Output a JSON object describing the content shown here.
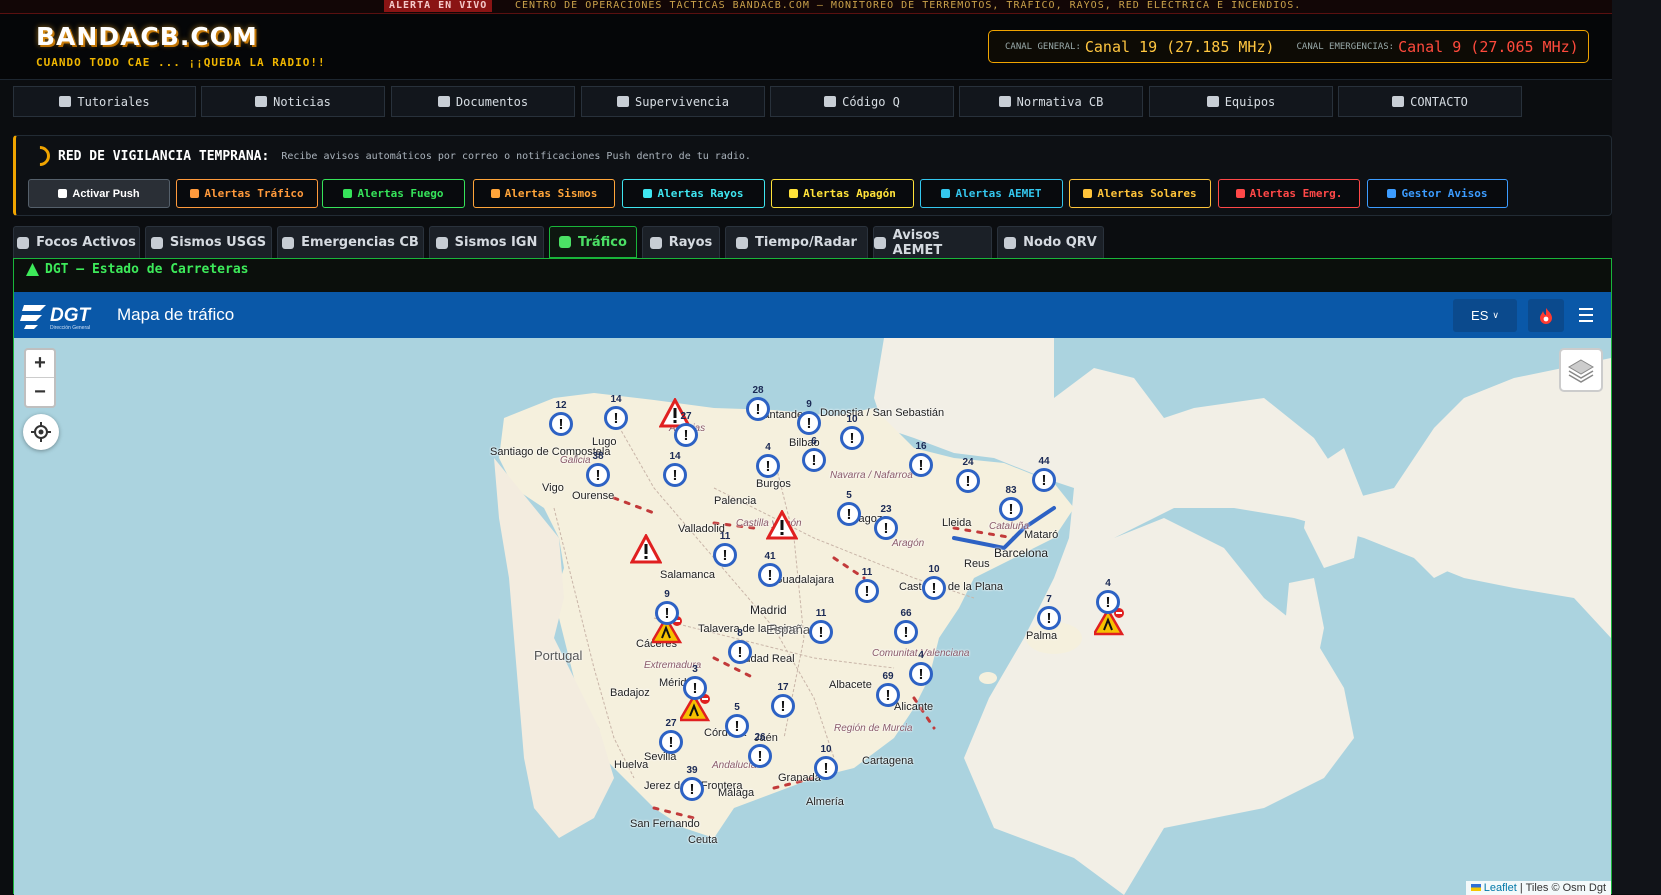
{
  "ticker": {
    "tag": "ALERTA EN VIVO",
    "message": "CENTRO DE OPERACIONES TÁCTICAS BANDACB.COM — MONITOREO DE TERREMOTOS, TRÁFICO, RAYOS, RED ELÉCTRICA E INCENDIOS."
  },
  "header": {
    "logo": "BANDACB.COM",
    "tagline": "CUANDO TODO CAE ... ¡¡QUEDA LA RADIO!!",
    "freq": {
      "general_label": "CANAL GENERAL:",
      "general_value": "Canal 19 (27.185 MHz)",
      "emergency_label": "CANAL EMERGENCIAS:",
      "emergency_value": "Canal 9 (27.065 MHz)"
    }
  },
  "nav": [
    {
      "label": "Tutoriales",
      "icon": "newspaper-icon"
    },
    {
      "label": "Noticias",
      "icon": "newspaper-icon"
    },
    {
      "label": "Documentos",
      "icon": "file-icon"
    },
    {
      "label": "Supervivencia",
      "icon": "kit-icon"
    },
    {
      "label": "Código Q",
      "icon": "id-card-icon"
    },
    {
      "label": "Normativa CB",
      "icon": "gavel-icon"
    },
    {
      "label": "Equipos",
      "icon": "radio-icon"
    },
    {
      "label": "CONTACTO",
      "icon": "envelope-icon"
    }
  ],
  "vigilancia": {
    "title": "RED DE VIGILANCIA TEMPRANA:",
    "description": "Recibe avisos automáticos por correo o notificaciones Push dentro de tu radio.",
    "buttons": [
      {
        "label": "Activar Push",
        "color": "#ffffff"
      },
      {
        "label": "Alertas Tráfico",
        "color": "#ff9a3c"
      },
      {
        "label": "Alertas Fuego",
        "color": "#36e35a"
      },
      {
        "label": "Alertas Sismos",
        "color": "#ffa53a"
      },
      {
        "label": "Alertas Rayos",
        "color": "#3fe6f0"
      },
      {
        "label": "Alertas Apagón",
        "color": "#ffe23a"
      },
      {
        "label": "Alertas AEMET",
        "color": "#34c7ee"
      },
      {
        "label": "Alertas Solares",
        "color": "#ffc43a"
      },
      {
        "label": "Alertas Emerg.",
        "color": "#ff4848"
      },
      {
        "label": "Gestor Avisos",
        "color": "#3c9cff"
      }
    ]
  },
  "tabs": [
    {
      "label": "Focos Activos",
      "icon": "fire-icon",
      "active": false
    },
    {
      "label": "Sismos USGS",
      "icon": "globe-icon",
      "active": false
    },
    {
      "label": "Emergencias CB",
      "icon": "truck-icon",
      "active": false
    },
    {
      "label": "Sismos IGN",
      "icon": "house-icon",
      "active": false
    },
    {
      "label": "Tráfico",
      "icon": "car-crash-icon",
      "active": true
    },
    {
      "label": "Rayos",
      "icon": "bolt-icon",
      "active": false
    },
    {
      "label": "Tiempo/Radar",
      "icon": "cloud-icon",
      "active": false
    },
    {
      "label": "Avisos AEMET",
      "icon": "warning-icon",
      "active": false
    },
    {
      "label": "Nodo QRV",
      "icon": "node-icon",
      "active": false
    }
  ],
  "panel": {
    "title": "DGT — Estado de Carreteras",
    "map_title": "Mapa de tráfico",
    "lang": "ES",
    "zoom_in": "+",
    "zoom_out": "−",
    "attribution_leaflet": "Leaflet",
    "attribution_rest": " | Tiles © Osm Dgt"
  },
  "map_labels": {
    "santiago": "Santiago de Compostela",
    "lugo": "Lugo",
    "vigo": "Vigo",
    "ourense": "Ourense",
    "palencia": "Palencia",
    "valladolid": "Valladolid",
    "salamanca": "Salamanca",
    "madrid": "Madrid",
    "guadalajara": "Guadalajara",
    "zaragoza": "Zaragoza",
    "lleida": "Lleida",
    "barcelona": "Barcelona",
    "mataro": "Mataró",
    "reus": "Reus",
    "caceres": "Cáceres",
    "talavera": "Talavera de la Reina",
    "merida": "Mérida",
    "badajoz": "Badajoz",
    "ciudad_real": "Ciudad Real",
    "albacete": "Albacete",
    "cordoba": "Córdoba",
    "jaen": "Jaén",
    "sevilla": "Sevilla",
    "huelva": "Huelva",
    "jerez": "Jerez de la Frontera",
    "malaga": "Málaga",
    "granada": "Granada",
    "almeria": "Almería",
    "cartagena": "Cartagena",
    "alicante": "Alicante",
    "castellon": "Castellón de la Plana",
    "palma": "Palma",
    "san_fernando": "San Fernando",
    "ceuta": "Ceuta",
    "bilbao": "Bilbao",
    "donostia": "Donostia / San Sebastián",
    "santander": "Santander",
    "burgos": "Burgos",
    "portugal": "Portugal",
    "espana": "España",
    "castilla": "Castilla y León",
    "extremadura": "Extremadura",
    "navarra": "Navarra / Nafarroa",
    "comunitat": "Comunitat Valenciana",
    "murcia": "Región de Murcia",
    "aragon": "Aragón",
    "andalucia": "Andalucía",
    "asturias": "Asturias",
    "galicia": "Galicia",
    "cataluna": "Cataluña"
  },
  "clusters": [
    {
      "count": "12"
    },
    {
      "count": "14"
    },
    {
      "count": "27"
    },
    {
      "count": "28"
    },
    {
      "count": "9"
    },
    {
      "count": "10"
    },
    {
      "count": "38"
    },
    {
      "count": "14"
    },
    {
      "count": "4"
    },
    {
      "count": "6"
    },
    {
      "count": "16"
    },
    {
      "count": "24"
    },
    {
      "count": "44"
    },
    {
      "count": "83"
    },
    {
      "count": "5"
    },
    {
      "count": "23"
    },
    {
      "count": "11"
    },
    {
      "count": "41"
    },
    {
      "count": "11"
    },
    {
      "count": "10"
    },
    {
      "count": "9"
    },
    {
      "count": "11"
    },
    {
      "count": "8"
    },
    {
      "count": "66"
    },
    {
      "count": "7"
    },
    {
      "count": "4"
    },
    {
      "count": "3"
    },
    {
      "count": "4"
    },
    {
      "count": "17"
    },
    {
      "count": "69"
    },
    {
      "count": "5"
    },
    {
      "count": "27"
    },
    {
      "count": "26"
    },
    {
      "count": "10"
    },
    {
      "count": "39"
    }
  ],
  "pin_glyph": "!"
}
